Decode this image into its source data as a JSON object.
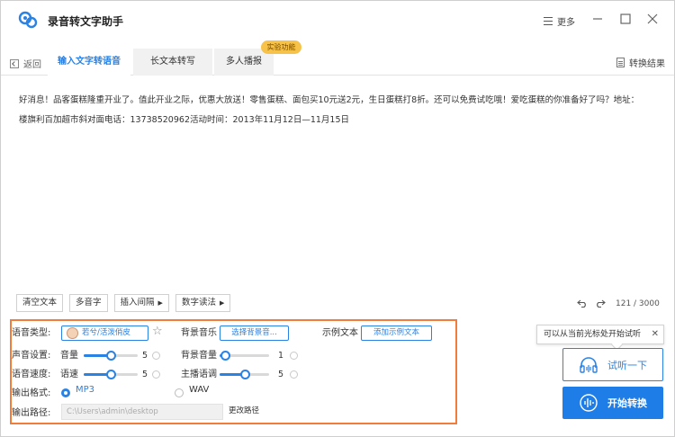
{
  "app": {
    "title": "录音转文字助手"
  },
  "window": {
    "more_label": "更多"
  },
  "tabs": {
    "back_label": "返回",
    "items": [
      {
        "label": "输入文字转语音"
      },
      {
        "label": "长文本转写"
      },
      {
        "label": "多人播报"
      }
    ],
    "experimental_badge": "实验功能",
    "result_label": "转换结果"
  },
  "editor": {
    "line1": "好消息！品客蛋糕隆重开业了。值此开业之际，优惠大放送！零售蛋糕、面包买10元送2元，生日蛋糕打8折。还可以免费试吃哦！爱吃蛋糕的你准备好了吗？地址：",
    "line2": "楼旗利百加超市斜对面电话：13738520962活动时间：2013年11月12日—11月15日"
  },
  "tools": {
    "clear": "清空文本",
    "polyphone": "多音字",
    "insert_pause": "插入间隔",
    "number_reading": "数字读法",
    "counter": "121 / 3000"
  },
  "settings": {
    "voice_type_label": "语音类型:",
    "voice_name": "若兮/活泼俏皮",
    "bg_music_label": "背景音乐",
    "bg_music_button": "选择背景音...",
    "sample_text_label": "示例文本",
    "sample_text_button": "添加示例文本",
    "sound_settings_label": "声音设置:",
    "volume_label": "音量",
    "volume_value": "5",
    "bg_volume_label": "背景音量",
    "bg_volume_value": "1",
    "speed_label": "语音速度:",
    "speed_sub_label": "语速",
    "speed_value": "5",
    "pitch_label": "主播语调",
    "pitch_value": "5",
    "format_label": "输出格式:",
    "format_options": [
      "MP3",
      "WAV"
    ],
    "format_selected": "MP3",
    "path_label": "输出路径:",
    "path_value": "C:\\Users\\admin\\desktop",
    "change_path": "更改路径",
    "levels": {
      "volume": 0.5,
      "bg_volume": 0.1,
      "speed": 0.5,
      "pitch": 0.5
    }
  },
  "actions": {
    "tooltip": "可以从当前光标处开始试听",
    "listen": "试听一下",
    "convert": "开始转换"
  },
  "colors": {
    "accent": "#1e7de6",
    "highlight_border": "#f07d3c",
    "badge": "#f6c24a"
  }
}
